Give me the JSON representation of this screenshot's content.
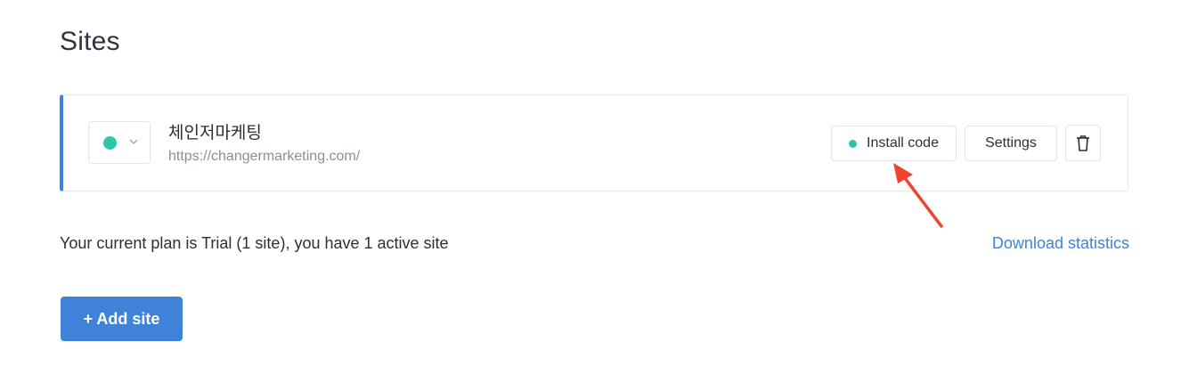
{
  "page": {
    "title": "Sites"
  },
  "site": {
    "name": "체인저마케팅",
    "url": "https://changermarketing.com/",
    "status_color": "#2dc6a8",
    "status_icon": "chevron-down-icon",
    "actions": {
      "install_label": "Install code",
      "settings_label": "Settings",
      "delete_icon": "trash-icon"
    }
  },
  "plan": {
    "text": "Your current plan is Trial (1 site), you have 1 active site",
    "download_label": "Download statistics"
  },
  "add_site": {
    "label": "+ Add site"
  },
  "colors": {
    "accent": "#3f83d9",
    "status_active": "#2dc6a8",
    "annotation": "#f0432f"
  }
}
